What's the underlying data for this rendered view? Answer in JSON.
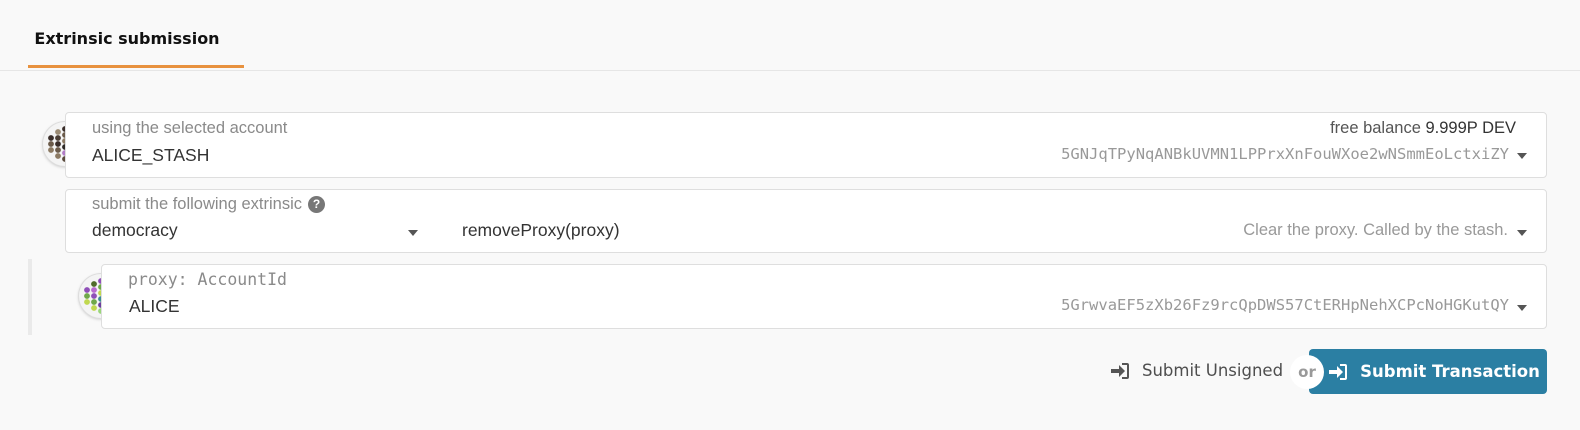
{
  "tabs": [
    {
      "label": "Extrinsic submission"
    }
  ],
  "account": {
    "label": "using the selected account",
    "name": "ALICE_STASH",
    "balance_label": "free balance",
    "balance_value": "9.999P DEV",
    "address": "5GNJqTPyNqANBkUVMN1LPPrxXnFouWXoe2wNSmmEoLctxiZY"
  },
  "extrinsic": {
    "label": "submit the following extrinsic",
    "help_icon": "question-circle-icon",
    "section": "democracy",
    "method": "removeProxy(proxy)",
    "description": "Clear the proxy. Called by the stash."
  },
  "param": {
    "label": "proxy: AccountId",
    "name": "ALICE",
    "address": "5GrwvaEF5zXb26Fz9rcQpDWS57CtERHpNehXCPcNoHGKutQY"
  },
  "actions": {
    "unsigned_label": "Submit Unsigned",
    "or_label": "or",
    "submit_label": "Submit Transaction",
    "submit_color": "#2b7fa3",
    "tab_accent": "#e8923f"
  }
}
